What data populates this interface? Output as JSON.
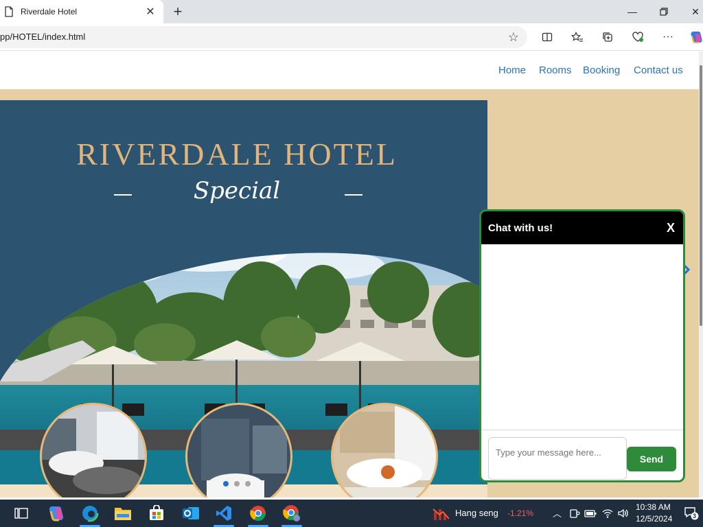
{
  "browser": {
    "tab_title": "Riverdale Hotel",
    "new_tab_symbol": "+",
    "url": "pp/HOTEL/index.html",
    "window_controls": [
      "minimize",
      "restore",
      "close"
    ],
    "toolbar_icons": [
      "split-screen-icon",
      "favorites-icon",
      "collections-icon",
      "browser-essentials-icon",
      "more-icon",
      "copilot-icon"
    ]
  },
  "nav": {
    "links": [
      "Home",
      "Rooms",
      "Booking",
      "Contact us"
    ]
  },
  "hero": {
    "title": "RIVERDALE HOTEL",
    "subtitle": "Special",
    "slides_count": 3,
    "active_slide": 0
  },
  "chat": {
    "title": "Chat with us!",
    "close_label": "X",
    "input_placeholder": "Type your message here...",
    "send_label": "Send"
  },
  "taskbar": {
    "apps": [
      "task-view",
      "copilot",
      "edge",
      "file-explorer",
      "microsoft-store",
      "outlook",
      "vscode",
      "chrome",
      "chrome-profile"
    ],
    "stock_name": "Hang seng",
    "stock_change": "-1.21%",
    "time": "10:38 AM",
    "date": "12/5/2024",
    "notification_count": "3"
  },
  "colors": {
    "hero_bg": "#2c5470",
    "page_beige": "#e6cfa2",
    "title_gold": "#e2b57c",
    "nav_link": "#2a73b8",
    "chat_border": "#2e8b3a",
    "send_button": "#2e8b3a"
  }
}
